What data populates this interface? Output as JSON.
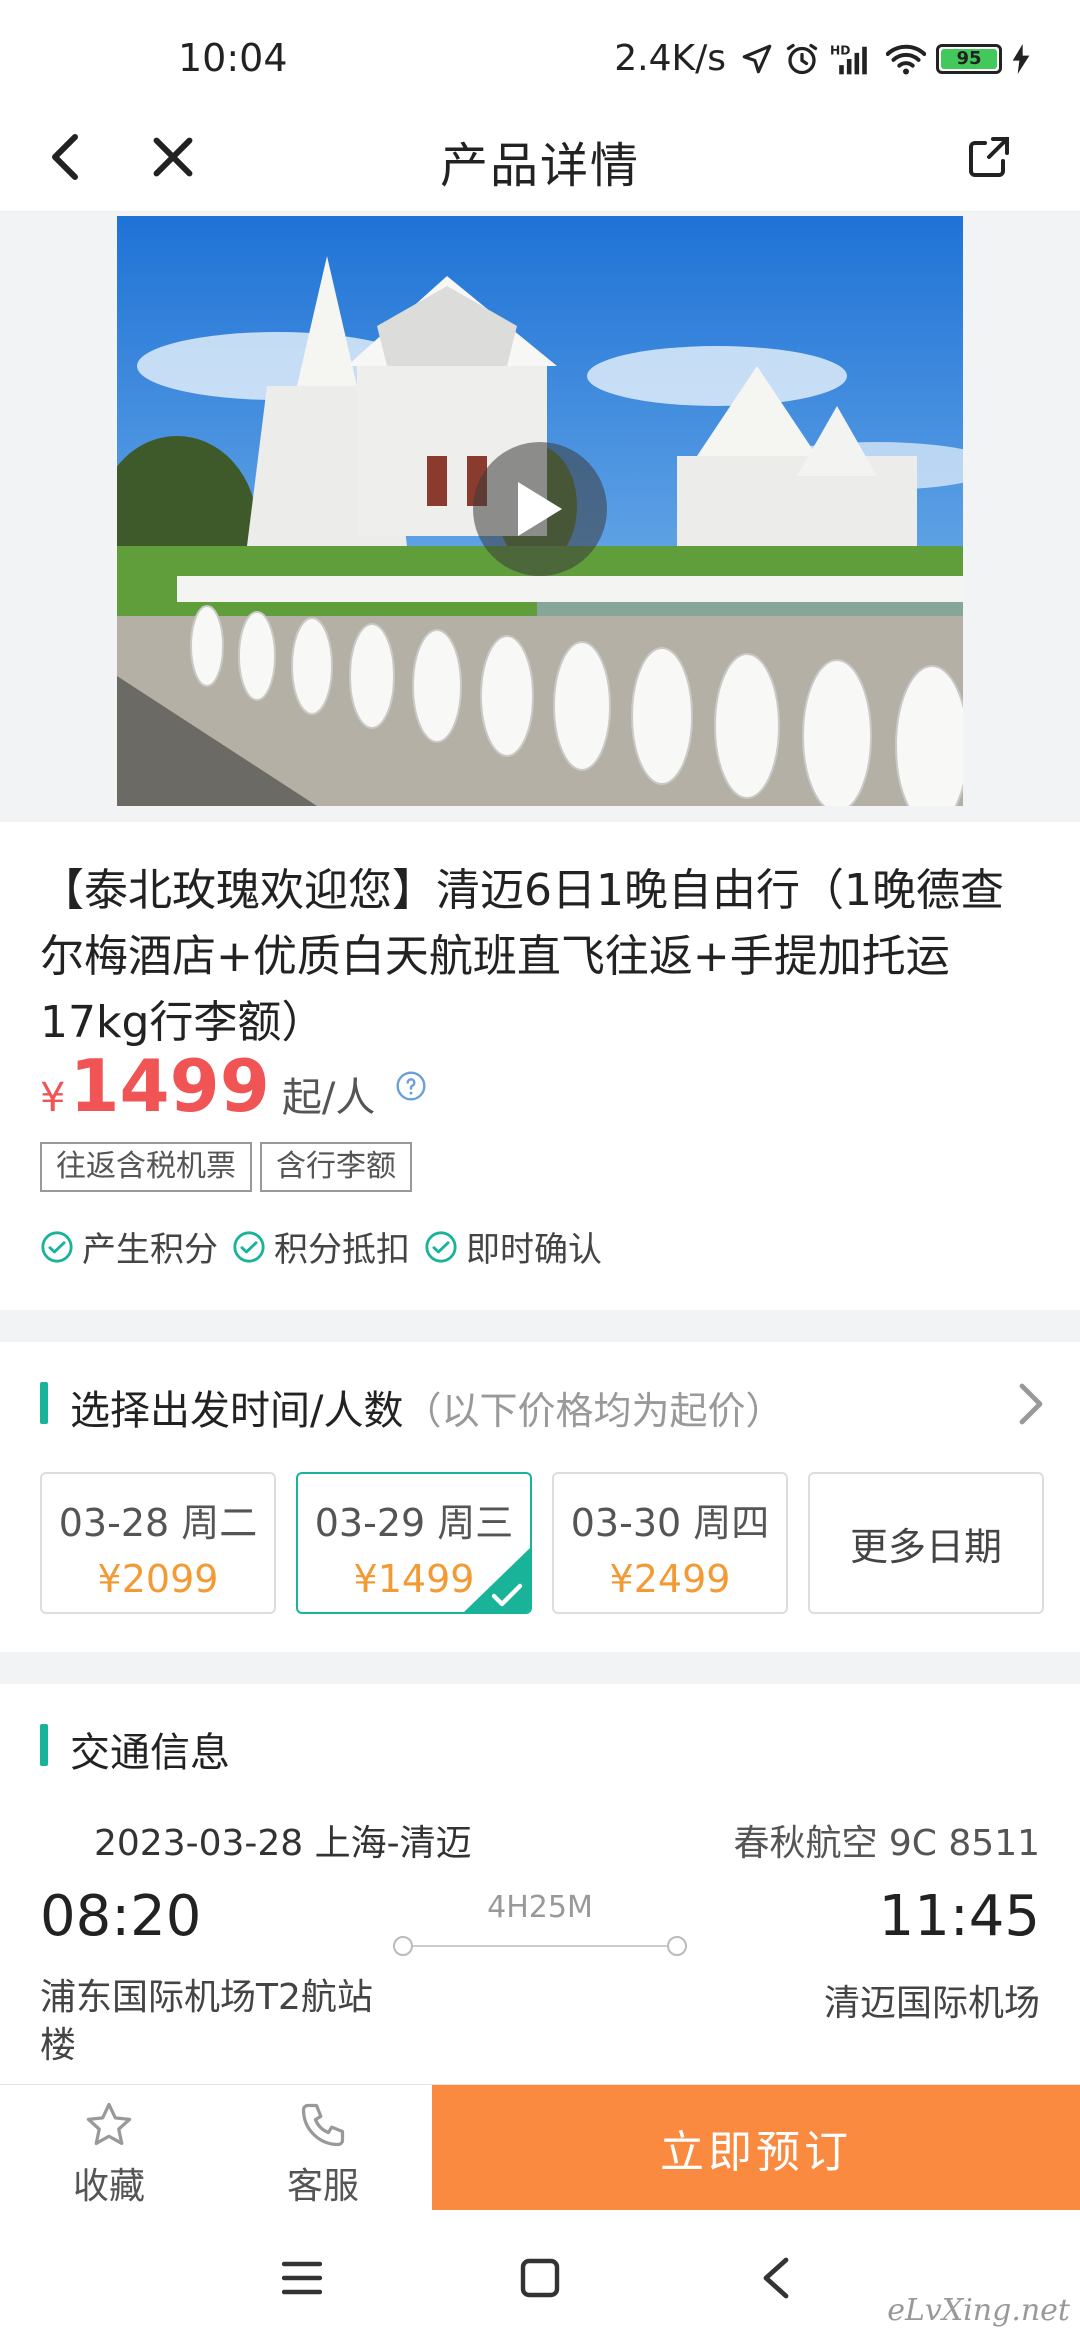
{
  "status_bar": {
    "time": "10:04",
    "net_speed": "2.4K/s",
    "battery": "95",
    "icons": [
      "location-arrow-icon",
      "alarm-icon",
      "hd-signal-icon",
      "wifi-icon",
      "battery-icon",
      "charging-icon"
    ]
  },
  "nav": {
    "title": "产品详情",
    "icons": [
      "back-icon",
      "close-icon",
      "share-icon"
    ]
  },
  "hero": {
    "image": "white temple photo",
    "play_icon": "play-icon"
  },
  "product": {
    "title": "【泰北玫瑰欢迎您】清迈6日1晚自由行（1晚德查尔梅酒店+优质白天航班直飞往返+手提加托运17kg行李额）",
    "price_symbol": "¥",
    "price": "1499",
    "price_unit": "起/人",
    "tags": [
      "往返含税机票",
      "含行李额"
    ],
    "features": [
      "产生积分",
      "积分抵扣",
      "即时确认"
    ]
  },
  "date_section": {
    "title": "选择出发时间/人数",
    "hint": "（以下价格均为起价）",
    "dates": [
      {
        "label": "03-28 周二",
        "price": "¥2099",
        "selected": false
      },
      {
        "label": "03-29 周三",
        "price": "¥1499",
        "selected": true
      },
      {
        "label": "03-30 周四",
        "price": "¥2499",
        "selected": false
      }
    ],
    "more_label": "更多日期"
  },
  "transport": {
    "title": "交通信息",
    "date_route": "2023-03-28 上海-清迈",
    "airline": "春秋航空 9C 8511",
    "dep_time": "08:20",
    "arr_time": "11:45",
    "duration": "4H25M",
    "dep_airport": "浦东国际机场T2航站楼",
    "arr_airport": "清迈国际机场"
  },
  "bottom_bar": {
    "favorite": "收藏",
    "service": "客服",
    "book": "立即预订"
  },
  "watermark": "eLvXing.net",
  "colors": {
    "accent_green": "#19b39a",
    "price_red": "#f05454",
    "date_price_orange": "#f39a35",
    "book_button": "#fb8a41"
  }
}
